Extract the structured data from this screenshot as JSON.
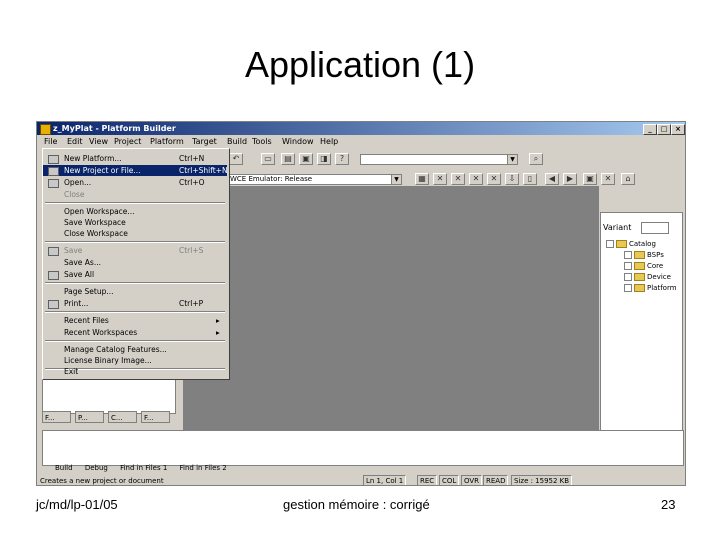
{
  "slide": {
    "title": "Application (1)",
    "footer_left": "jc/md/lp-01/05",
    "footer_center": "gestion mémoire : corrigé",
    "footer_right": "23"
  },
  "window": {
    "title": "z_MyPlat - Platform Builder",
    "controls": [
      "_",
      "□",
      "×"
    ],
    "menubar": [
      "File",
      "Edit",
      "View",
      "Project",
      "Platform",
      "Target",
      "Build",
      "Tools",
      "Window",
      "Help"
    ],
    "config_combo": "WCE Emulator: Release"
  },
  "file_menu": {
    "items": [
      {
        "label": "New Platform...",
        "shortcut": "Ctrl+N",
        "icon": "new-icon"
      },
      {
        "label": "New Project or File...",
        "shortcut": "Ctrl+Shift+N",
        "icon": "new-file-icon"
      },
      {
        "label": "Open...",
        "shortcut": "Ctrl+O",
        "icon": "open-icon"
      },
      {
        "label": "Close",
        "shortcut": ""
      },
      {
        "label": "Open Workspace...",
        "shortcut": ""
      },
      {
        "label": "Save Workspace",
        "shortcut": ""
      },
      {
        "label": "Close Workspace",
        "shortcut": ""
      },
      {
        "label": "Save",
        "shortcut": "Ctrl+S",
        "icon": "save-icon"
      },
      {
        "label": "Save As...",
        "shortcut": ""
      },
      {
        "label": "Save All",
        "shortcut": "",
        "icon": "save-all-icon"
      },
      {
        "label": "Page Setup...",
        "shortcut": ""
      },
      {
        "label": "Print...",
        "shortcut": "Ctrl+P",
        "icon": "print-icon"
      },
      {
        "label": "Recent Files",
        "shortcut": ""
      },
      {
        "label": "Recent Workspaces",
        "shortcut": ""
      },
      {
        "label": "Manage Catalog Features...",
        "shortcut": ""
      },
      {
        "label": "License Binary Image...",
        "shortcut": ""
      },
      {
        "label": "Exit",
        "shortcut": ""
      }
    ]
  },
  "left_tabs": [
    "F...",
    "P...",
    "C...",
    "F..."
  ],
  "right_pane": {
    "header": "Variant",
    "tree_root": "Catalog",
    "tree_items": [
      "BSPs",
      "Core",
      "Device",
      "Platform"
    ]
  },
  "output_tabs": [
    "Build",
    "Debug",
    "Find in Files 1",
    "Find in Files 2"
  ],
  "status": {
    "message": "Creates a new project or document",
    "position": "Ln 1, Col 1",
    "indicators": [
      "REC",
      "COL",
      "OVR",
      "READ"
    ],
    "size": "Size : 15952 KB"
  },
  "colors": {
    "selection": "#0a246a",
    "face": "#d4d0c8",
    "mdi_background": "#808080"
  }
}
